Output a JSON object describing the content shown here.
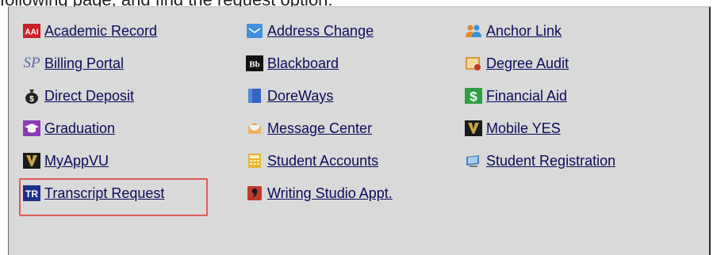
{
  "caption": "following page, and find the request option:",
  "links": {
    "col1": [
      {
        "label": "Academic Record",
        "icon": "aai-icon"
      },
      {
        "label": "Billing Portal",
        "icon": "sp-icon"
      },
      {
        "label": "Direct Deposit",
        "icon": "money-bag-icon"
      },
      {
        "label": "Graduation",
        "icon": "graduation-cap-icon"
      },
      {
        "label": "MyAppVU",
        "icon": "vanderbilt-v-icon"
      },
      {
        "label": "Transcript Request",
        "icon": "tr-icon"
      }
    ],
    "col2": [
      {
        "label": "Address Change",
        "icon": "envelope-icon"
      },
      {
        "label": "Blackboard",
        "icon": "blackboard-icon"
      },
      {
        "label": "DoreWays",
        "icon": "blue-square-icon"
      },
      {
        "label": "Message Center",
        "icon": "message-center-icon"
      },
      {
        "label": "Student Accounts",
        "icon": "calculator-icon"
      },
      {
        "label": "Writing Studio Appt.",
        "icon": "writing-studio-icon"
      }
    ],
    "col3": [
      {
        "label": "Anchor Link",
        "icon": "people-icon"
      },
      {
        "label": "Degree Audit",
        "icon": "degree-audit-icon"
      },
      {
        "label": "Financial Aid",
        "icon": "dollar-icon"
      },
      {
        "label": "Mobile YES",
        "icon": "vanderbilt-v-icon"
      },
      {
        "label": "Student Registration",
        "icon": "monitor-icon"
      }
    ]
  },
  "icon_text": {
    "aai": "AAI",
    "sp": "SP",
    "bb": "Bb",
    "tr": "TR",
    "dollar": "$",
    "v": "V"
  },
  "highlighted": "Transcript Request",
  "colors": {
    "link": "#0b0b5c",
    "panel": "#d9d9d9",
    "highlight": "#e05a57"
  }
}
